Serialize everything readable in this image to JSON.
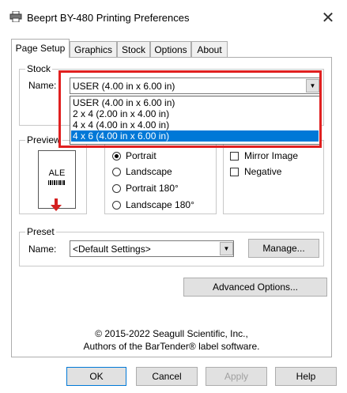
{
  "window": {
    "title": "Beeprt BY-480 Printing Preferences",
    "close_glyph": "✕"
  },
  "tabs": [
    {
      "label": "Page Setup",
      "active": true
    },
    {
      "label": "Graphics"
    },
    {
      "label": "Stock"
    },
    {
      "label": "Options"
    },
    {
      "label": "About"
    }
  ],
  "stock": {
    "group_label": "Stock",
    "name_label": "Name:",
    "selected_value": "USER (4.00 in x 6.00 in)",
    "options": [
      "USER (4.00 in x 6.00 in)",
      "2 x 4 (2.00 in x 4.00 in)",
      "4 x 4 (4.00 in x 4.00 in)",
      "4 x 6 (4.00 in x 6.00 in)"
    ],
    "highlighted_index": 3
  },
  "preview": {
    "group_label": "Preview",
    "label_text": "ALE"
  },
  "orientation": {
    "options": [
      {
        "label": "Portrait",
        "selected": true
      },
      {
        "label": "Landscape",
        "selected": false
      },
      {
        "label": "Portrait 180°",
        "selected": false
      },
      {
        "label": "Landscape 180°",
        "selected": false
      }
    ]
  },
  "effects": {
    "options": [
      {
        "label": "Mirror Image",
        "checked": false
      },
      {
        "label": "Negative",
        "checked": false
      }
    ]
  },
  "preset": {
    "group_label": "Preset",
    "name_label": "Name:",
    "value": "<Default Settings>",
    "manage_label": "Manage..."
  },
  "advanced_label": "Advanced Options...",
  "copyright": {
    "line1": "© 2015-2022 Seagull Scientific, Inc.,",
    "line2": "Authors of the BarTender® label software."
  },
  "footer": {
    "ok": "OK",
    "cancel": "Cancel",
    "apply": "Apply",
    "help": "Help"
  },
  "colors": {
    "selection": "#0078d7",
    "highlight_outline": "#e02020",
    "arrow_red": "#d42020"
  }
}
